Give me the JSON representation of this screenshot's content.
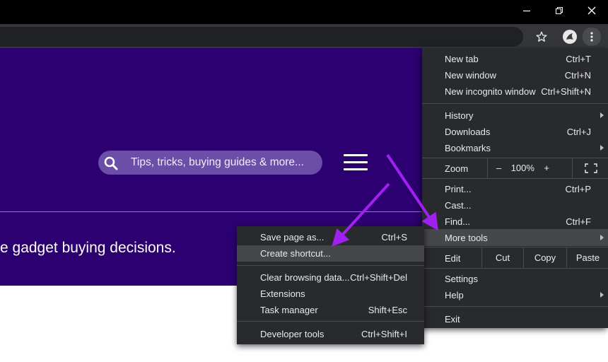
{
  "window": {
    "controls": [
      {
        "name": "minimize-button",
        "icon": "minimize-icon"
      },
      {
        "name": "restore-button",
        "icon": "restore-icon"
      },
      {
        "name": "close-button",
        "icon": "close-icon"
      }
    ]
  },
  "toolbar": {
    "icons": [
      "bookmark-star-icon",
      "profile-avatar-icon",
      "chrome-menu-icon"
    ]
  },
  "page": {
    "search_placeholder": "Tips, tricks, buying guides & more...",
    "tagline": "e gadget buying decisions."
  },
  "chrome_menu": {
    "items": [
      {
        "label": "New tab",
        "shortcut": "Ctrl+T"
      },
      {
        "label": "New window",
        "shortcut": "Ctrl+N"
      },
      {
        "label": "New incognito window",
        "shortcut": "Ctrl+Shift+N"
      },
      {
        "label": "History",
        "shortcut": ""
      },
      {
        "label": "Downloads",
        "shortcut": "Ctrl+J"
      },
      {
        "label": "Bookmarks",
        "shortcut": ""
      },
      {
        "label": "Print...",
        "shortcut": "Ctrl+P"
      },
      {
        "label": "Cast...",
        "shortcut": ""
      },
      {
        "label": "Find...",
        "shortcut": "Ctrl+F"
      },
      {
        "label": "More tools",
        "shortcut": ""
      },
      {
        "label": "Settings",
        "shortcut": ""
      },
      {
        "label": "Help",
        "shortcut": ""
      },
      {
        "label": "Exit",
        "shortcut": ""
      }
    ],
    "zoom": {
      "label": "Zoom",
      "minus": "–",
      "value": "100%",
      "plus": "+",
      "fullscreen_icon": "fullscreen-icon"
    },
    "edit": {
      "label": "Edit",
      "cut": "Cut",
      "copy": "Copy",
      "paste": "Paste"
    }
  },
  "more_tools_menu": {
    "items": [
      {
        "label": "Save page as...",
        "shortcut": "Ctrl+S"
      },
      {
        "label": "Create shortcut...",
        "shortcut": ""
      },
      {
        "label": "Clear browsing data...",
        "shortcut": "Ctrl+Shift+Del"
      },
      {
        "label": "Extensions",
        "shortcut": ""
      },
      {
        "label": "Task manager",
        "shortcut": "Shift+Esc"
      },
      {
        "label": "Developer tools",
        "shortcut": "Ctrl+Shift+I"
      }
    ]
  },
  "colors": {
    "hero": "#2c0070",
    "menu_bg": "#292a2d",
    "highlight": "#46474b",
    "annotation_arrow": "#a020f0"
  }
}
